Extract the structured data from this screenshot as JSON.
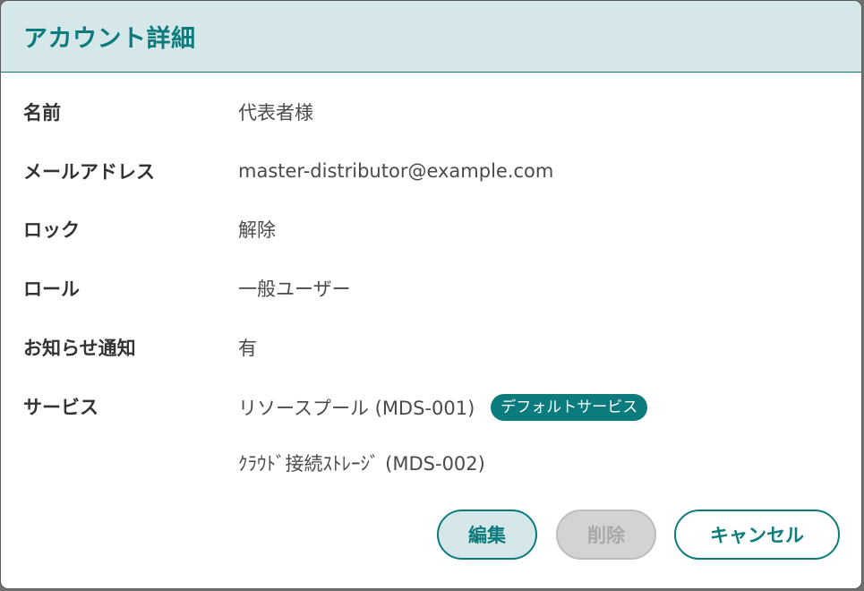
{
  "dialog": {
    "title": "アカウント詳細"
  },
  "fields": {
    "name": {
      "label": "名前",
      "value": "代表者様"
    },
    "email": {
      "label": "メールアドレス",
      "value": "master-distributor@example.com"
    },
    "lock": {
      "label": "ロック",
      "value": "解除"
    },
    "role": {
      "label": "ロール",
      "value": "一般ユーザー"
    },
    "notification": {
      "label": "お知らせ通知",
      "value": "有"
    },
    "services": {
      "label": "サービス",
      "items": [
        {
          "name": "リソースプール (MDS-001)",
          "badge": "デフォルトサービス"
        },
        {
          "name": "ｸﾗｳﾄﾞ接続ｽﾄﾚｰｼﾞ (MDS-002)"
        }
      ]
    }
  },
  "buttons": {
    "edit": "編集",
    "delete": "削除",
    "cancel": "キャンセル"
  },
  "colors": {
    "accent": "#0c7b7d",
    "header_bg": "#d5e7e8",
    "disabled_bg": "#d3d3d3"
  }
}
